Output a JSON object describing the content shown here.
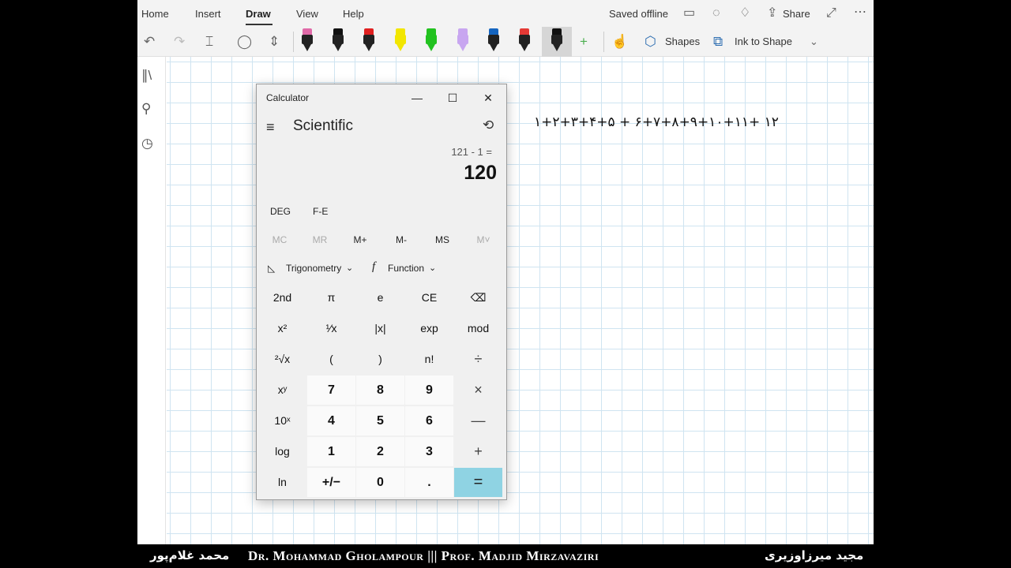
{
  "menubar": {
    "items": [
      "Home",
      "Insert",
      "Draw",
      "View",
      "Help"
    ],
    "saved_status": "Saved offline",
    "share_label": "Share"
  },
  "toolbar": {
    "shapes_label": "Shapes",
    "ink_to_shape_label": "Ink to Shape",
    "pens": [
      {
        "name": "pen-pink",
        "color": "#e06aa8"
      },
      {
        "name": "pen-black",
        "color": "#111111"
      },
      {
        "name": "pen-red",
        "color": "#e02020"
      },
      {
        "name": "highlighter-yellow",
        "color": "#f2e600"
      },
      {
        "name": "highlighter-green",
        "color": "#22c21f"
      },
      {
        "name": "highlighter-lavender",
        "color": "#c8a6f0"
      },
      {
        "name": "pen-blue",
        "color": "#1565c0"
      },
      {
        "name": "pen-red-2",
        "color": "#e53935"
      },
      {
        "name": "pen-black-active",
        "color": "#111111"
      }
    ]
  },
  "canvas": {
    "handwriting": "۱+۲+۳+۴+۵ + ۶+۷+۸+۹+۱۰+۱۱+ ۱۲"
  },
  "calculator": {
    "title": "Calculator",
    "mode": "Scientific",
    "expression": "121 - 1 =",
    "display": "120",
    "angle_mode": "DEG",
    "fe_label": "F-E",
    "memory": [
      "MC",
      "MR",
      "M+",
      "M-",
      "MS",
      "M˅"
    ],
    "trig_label": "Trigonometry",
    "function_label": "Function",
    "keys": [
      [
        "2nd",
        "π",
        "e",
        "CE",
        "⌫"
      ],
      [
        "x²",
        "¹⁄x",
        "|x|",
        "exp",
        "mod"
      ],
      [
        "²√x",
        "(",
        ")",
        "n!",
        "÷"
      ],
      [
        "xʸ",
        "7",
        "8",
        "9",
        "×"
      ],
      [
        "10ˣ",
        "4",
        "5",
        "6",
        "—"
      ],
      [
        "log",
        "1",
        "2",
        "3",
        "+"
      ],
      [
        "ln",
        "+/−",
        "0",
        ".",
        "="
      ]
    ]
  },
  "footer": {
    "persian_left": "محمد غلام‌پور",
    "english": "Dr. Mohammad Gholampour ||| Prof. Madjid Mirzavaziri",
    "persian_right": "مجید میرزاوزیری"
  },
  "colors": {
    "accent_equals": "#8fd3e3",
    "grid": "#cfe4f1"
  }
}
